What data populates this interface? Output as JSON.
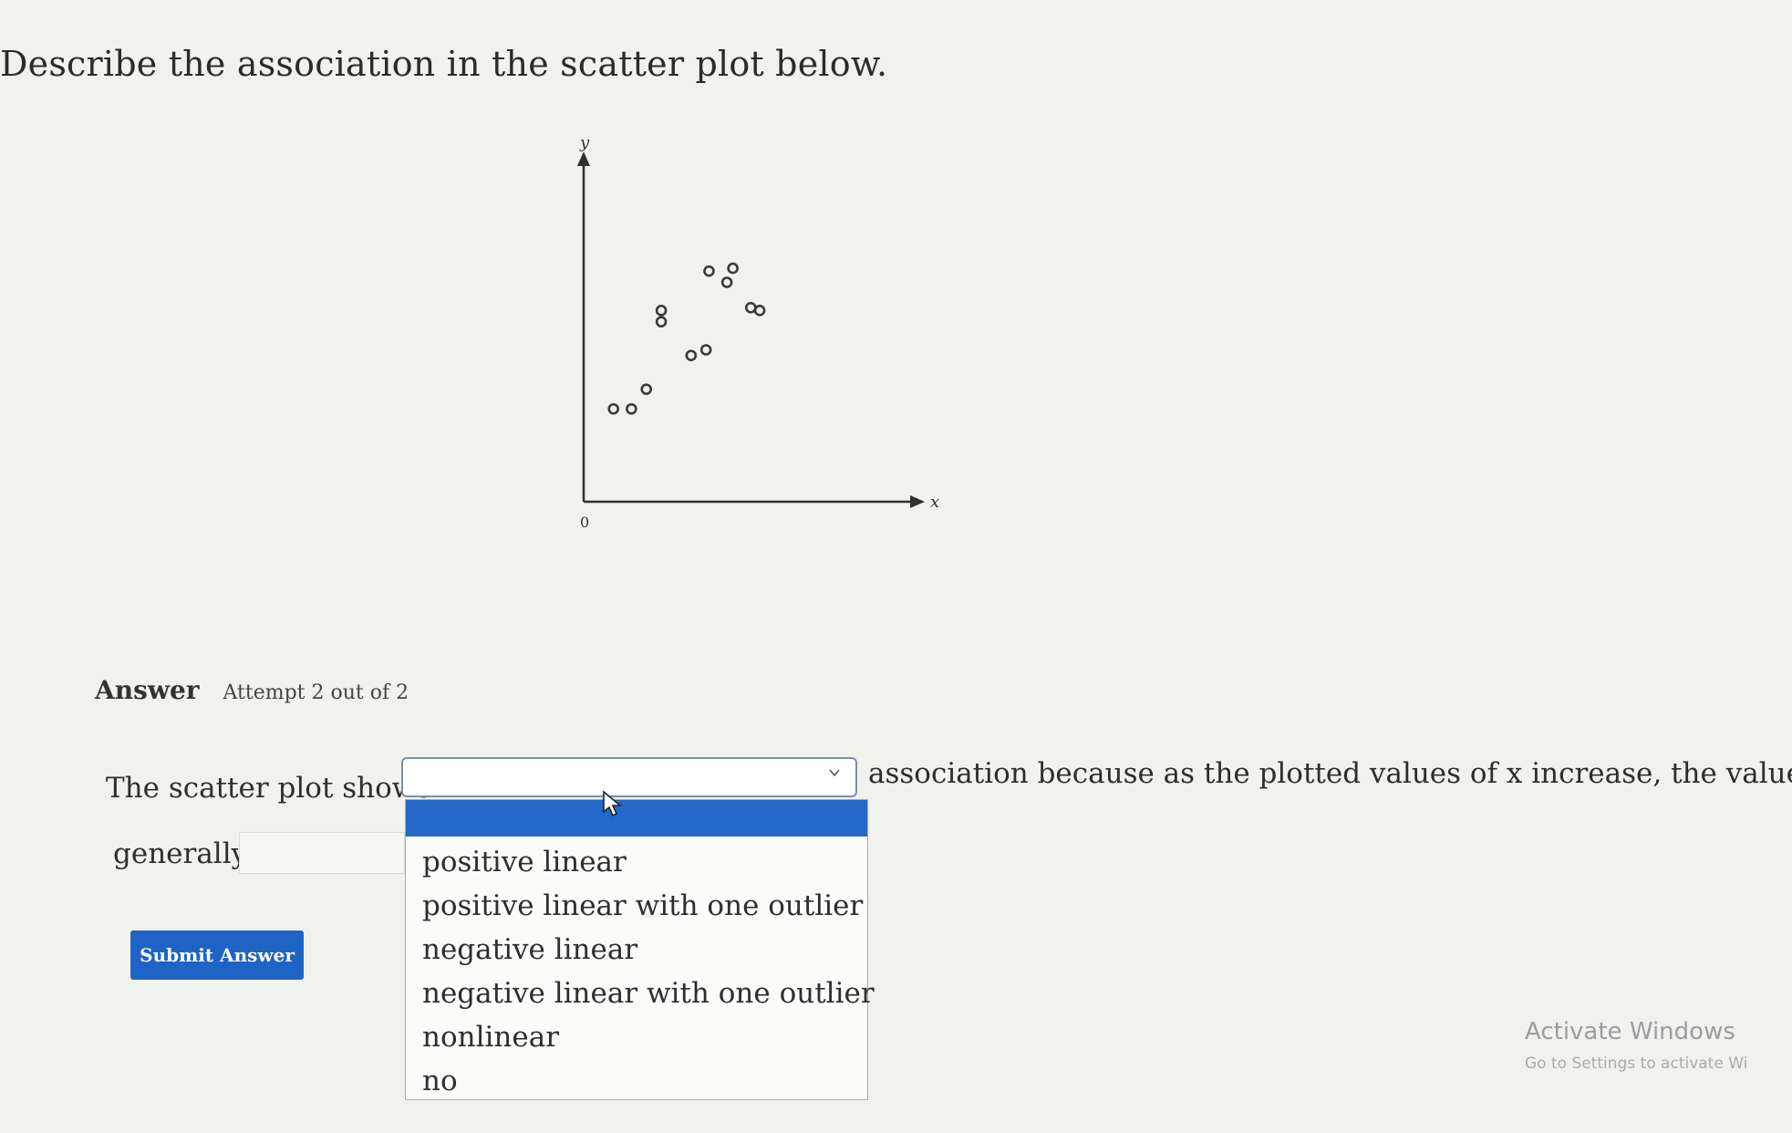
{
  "question": "Describe the association in the scatter plot below.",
  "chart_data": {
    "type": "scatter",
    "title": "",
    "xlabel": "x",
    "ylabel": "y",
    "origin_label": "0",
    "xlim": [
      0,
      11
    ],
    "ylim": [
      0,
      12
    ],
    "grid": false,
    "points": [
      {
        "x": 1.0,
        "y": 3.3
      },
      {
        "x": 1.6,
        "y": 3.3
      },
      {
        "x": 2.1,
        "y": 4.0
      },
      {
        "x": 2.6,
        "y": 6.8
      },
      {
        "x": 2.6,
        "y": 6.4
      },
      {
        "x": 3.6,
        "y": 5.2
      },
      {
        "x": 4.1,
        "y": 5.4
      },
      {
        "x": 4.2,
        "y": 8.2
      },
      {
        "x": 4.8,
        "y": 7.8
      },
      {
        "x": 5.0,
        "y": 8.3
      },
      {
        "x": 5.6,
        "y": 6.9
      },
      {
        "x": 5.9,
        "y": 6.8
      }
    ],
    "marker_color": "#3a3a3a"
  },
  "answer": {
    "label": "Answer",
    "attempt": "Attempt 2 out of 2"
  },
  "statement": {
    "prefix": "The scatter plot shows",
    "middle": "association because as the plotted values of x increase, the values of y",
    "line2_prefix": "generally"
  },
  "dropdown": {
    "selected": "",
    "options": [
      "positive linear",
      "positive linear with one outlier",
      "negative linear",
      "negative linear with one outlier",
      "nonlinear",
      "no"
    ]
  },
  "submit_label": "Submit Answer",
  "watermark": {
    "title": "Activate Windows",
    "subtitle": "Go to Settings to activate Wi"
  },
  "colors": {
    "button": "#1f63c4",
    "highlight": "#2468c8"
  }
}
